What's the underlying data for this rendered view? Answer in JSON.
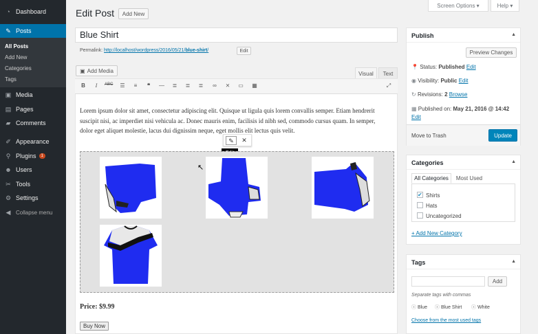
{
  "menu": {
    "items": [
      {
        "label": "Dashboard",
        "icon": "dashboard-icon"
      },
      {
        "label": "Posts",
        "icon": "pin-icon"
      },
      {
        "label": "Media",
        "icon": "media-icon"
      },
      {
        "label": "Pages",
        "icon": "pages-icon"
      },
      {
        "label": "Comments",
        "icon": "comments-icon"
      },
      {
        "label": "Appearance",
        "icon": "appearance-icon"
      },
      {
        "label": "Plugins",
        "icon": "plugins-icon",
        "badge": "1"
      },
      {
        "label": "Users",
        "icon": "users-icon"
      },
      {
        "label": "Tools",
        "icon": "tools-icon"
      },
      {
        "label": "Settings",
        "icon": "settings-icon"
      }
    ],
    "submenu": [
      "All Posts",
      "Add New",
      "Categories",
      "Tags"
    ],
    "collapse": "Collapse menu"
  },
  "header": {
    "title": "Edit Post",
    "add_new": "Add New",
    "screen_options": "Screen Options ▾",
    "help": "Help ▾"
  },
  "post": {
    "title": "Blue Shirt",
    "permalink_label": "Permalink:",
    "permalink_base": "http://localhost/wordpress/2016/05/21/",
    "permalink_slug": "blue-shirt",
    "permalink_end": "/",
    "permalink_edit": "Edit"
  },
  "editor": {
    "add_media": "Add Media",
    "tab_visual": "Visual",
    "tab_text": "Text",
    "paragraph": "Lorem ipsum dolor sit amet, consectetur adipiscing elit. Quisque ut ligula quis lorem convallis semper. Etiam hendrerit suscipit nisi, ac imperdiet nisi vehicula ac. Donec mauris enim, facilisis id nibh sed, commodo cursus quam. In semper, dolor eget aliquet molestie, lacus dui dignissim neque, eget mollis elit lectus quis velit.",
    "tooltip": "Edit",
    "price": "Price: $9.99",
    "buy": "Buy Now"
  },
  "publish": {
    "title": "Publish",
    "preview": "Preview Changes",
    "status_label": "Status:",
    "status_value": "Published",
    "visibility_label": "Visibility:",
    "visibility_value": "Public",
    "revisions_label": "Revisions:",
    "revisions_value": "2",
    "browse": "Browse",
    "published_label": "Published on:",
    "published_value": "May 21, 2016 @ 14:42",
    "edit": "Edit",
    "trash": "Move to Trash",
    "update": "Update"
  },
  "categories": {
    "title": "Categories",
    "tab_all": "All Categories",
    "tab_used": "Most Used",
    "items": [
      {
        "label": "Shirts",
        "checked": true
      },
      {
        "label": "Hats",
        "checked": false
      },
      {
        "label": "Uncategorized",
        "checked": false
      }
    ],
    "add": "+ Add New Category"
  },
  "tags": {
    "title": "Tags",
    "add_btn": "Add",
    "hint": "Separate tags with commas",
    "items": [
      "Blue",
      "Blue Shirt",
      "White"
    ],
    "choose": "Choose from the most used tags"
  },
  "colors": {
    "sidebar": "#23282d",
    "accent": "#0073aa",
    "shirt": "#1f2cf0"
  }
}
